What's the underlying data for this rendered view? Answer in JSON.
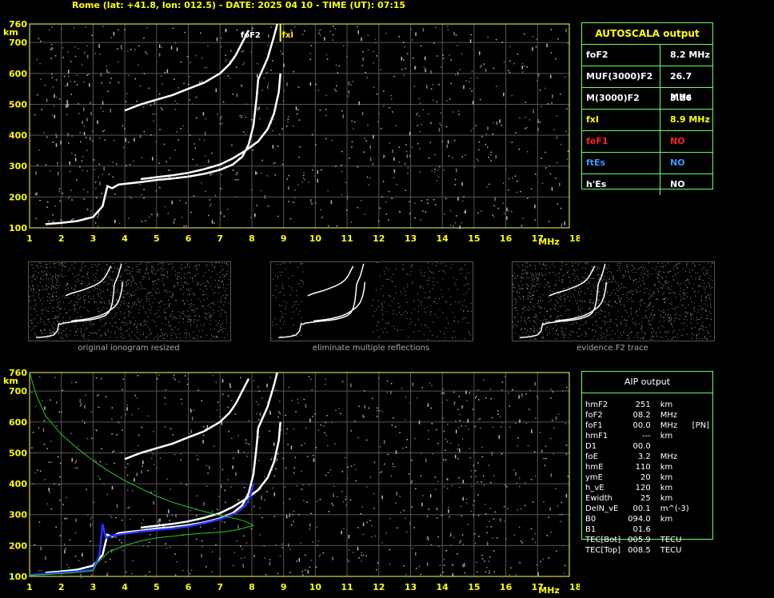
{
  "header": {
    "title": "Rome (lat: +41.8, lon: 012.5) - DATE: 2025 04 10 - TIME (UT): 07:15"
  },
  "chart_data": [
    {
      "type": "scatter",
      "title": "",
      "xlabel": "MHz",
      "ylabel": "km",
      "xlim": [
        1,
        18
      ],
      "ylim": [
        100,
        760
      ],
      "x_ticks": [
        1,
        2,
        3,
        4,
        5,
        6,
        7,
        8,
        9,
        10,
        11,
        12,
        13,
        14,
        15,
        16,
        17,
        18
      ],
      "y_ticks": [
        100,
        200,
        300,
        400,
        500,
        600,
        700,
        760
      ],
      "grid": true,
      "annotations": [
        {
          "text": "foF2",
          "x": 8.2,
          "color": "#ffffff"
        },
        {
          "text": "fxl",
          "x": 8.9,
          "color": "#ffff00"
        }
      ],
      "series": [
        {
          "color": "#ffffff",
          "points": [
            [
              1.5,
              112
            ],
            [
              2.0,
              116
            ],
            [
              2.5,
              122
            ],
            [
              3.0,
              135
            ],
            [
              3.3,
              170
            ],
            [
              3.45,
              235
            ],
            [
              3.6,
              228
            ],
            [
              3.8,
              240
            ],
            [
              4.5,
              248
            ],
            [
              5.0,
              255
            ],
            [
              5.5,
              260
            ],
            [
              6.0,
              266
            ],
            [
              6.5,
              275
            ],
            [
              7.0,
              288
            ],
            [
              7.4,
              305
            ],
            [
              7.7,
              330
            ],
            [
              7.9,
              370
            ],
            [
              8.05,
              430
            ],
            [
              8.15,
              520
            ],
            [
              8.2,
              580
            ],
            [
              8.5,
              650
            ],
            [
              8.7,
              720
            ],
            [
              8.8,
              760
            ]
          ]
        },
        {
          "color": "#ffffff",
          "points": [
            [
              4.5,
              258
            ],
            [
              5.0,
              264
            ],
            [
              5.5,
              270
            ],
            [
              6.0,
              278
            ],
            [
              6.5,
              290
            ],
            [
              7.0,
              305
            ],
            [
              7.4,
              325
            ],
            [
              7.8,
              350
            ],
            [
              8.2,
              380
            ],
            [
              8.5,
              420
            ],
            [
              8.7,
              470
            ],
            [
              8.85,
              540
            ],
            [
              8.9,
              600
            ]
          ]
        },
        {
          "color": "#ffffff",
          "points": [
            [
              4.0,
              480
            ],
            [
              4.5,
              500
            ],
            [
              5.0,
              515
            ],
            [
              5.5,
              530
            ],
            [
              6.0,
              550
            ],
            [
              6.5,
              570
            ],
            [
              7.0,
              600
            ],
            [
              7.3,
              630
            ],
            [
              7.5,
              660
            ],
            [
              7.7,
              700
            ],
            [
              7.9,
              740
            ]
          ]
        }
      ]
    },
    {
      "type": "scatter",
      "title": "",
      "xlabel": "MHz",
      "ylabel": "km",
      "xlim": [
        1,
        18
      ],
      "ylim": [
        100,
        760
      ],
      "x_ticks": [
        1,
        2,
        3,
        4,
        5,
        6,
        7,
        8,
        9,
        10,
        11,
        12,
        13,
        14,
        15,
        16,
        17,
        18
      ],
      "y_ticks": [
        100,
        200,
        300,
        400,
        500,
        600,
        700,
        760
      ],
      "grid": true,
      "series": [
        {
          "color": "#ffffff",
          "points": [
            [
              1.5,
              112
            ],
            [
              2.0,
              116
            ],
            [
              2.5,
              122
            ],
            [
              3.0,
              135
            ],
            [
              3.3,
              170
            ],
            [
              3.45,
              235
            ],
            [
              3.6,
              228
            ],
            [
              3.8,
              240
            ],
            [
              4.5,
              248
            ],
            [
              5.0,
              255
            ],
            [
              5.5,
              260
            ],
            [
              6.0,
              266
            ],
            [
              6.5,
              275
            ],
            [
              7.0,
              288
            ],
            [
              7.4,
              305
            ],
            [
              7.7,
              330
            ],
            [
              7.9,
              370
            ],
            [
              8.05,
              430
            ],
            [
              8.15,
              520
            ],
            [
              8.2,
              580
            ],
            [
              8.5,
              650
            ],
            [
              8.7,
              720
            ],
            [
              8.8,
              760
            ]
          ]
        },
        {
          "color": "#ffffff",
          "points": [
            [
              4.5,
              258
            ],
            [
              5.0,
              264
            ],
            [
              5.5,
              270
            ],
            [
              6.0,
              278
            ],
            [
              6.5,
              290
            ],
            [
              7.0,
              305
            ],
            [
              7.4,
              325
            ],
            [
              7.8,
              350
            ],
            [
              8.2,
              380
            ],
            [
              8.5,
              420
            ],
            [
              8.7,
              470
            ],
            [
              8.85,
              540
            ],
            [
              8.9,
              600
            ]
          ]
        },
        {
          "color": "#ffffff",
          "points": [
            [
              4.0,
              480
            ],
            [
              4.5,
              500
            ],
            [
              5.0,
              515
            ],
            [
              5.5,
              530
            ],
            [
              6.0,
              550
            ],
            [
              6.5,
              570
            ],
            [
              7.0,
              600
            ],
            [
              7.3,
              630
            ],
            [
              7.5,
              660
            ],
            [
              7.7,
              700
            ],
            [
              7.9,
              740
            ]
          ]
        },
        {
          "color": "#2233ff",
          "points": [
            [
              1.0,
              105
            ],
            [
              1.5,
              108
            ],
            [
              2.0,
              112
            ],
            [
              2.5,
              116
            ],
            [
              3.0,
              122
            ],
            [
              3.2,
              170
            ],
            [
              3.3,
              270
            ],
            [
              3.4,
              225
            ],
            [
              3.6,
              232
            ],
            [
              4.0,
              238
            ],
            [
              4.5,
              245
            ],
            [
              5.0,
              250
            ],
            [
              5.5,
              255
            ],
            [
              6.0,
              262
            ],
            [
              6.5,
              272
            ],
            [
              7.0,
              285
            ],
            [
              7.5,
              305
            ],
            [
              7.8,
              330
            ],
            [
              7.95,
              360
            ],
            [
              8.05,
              400
            ]
          ]
        },
        {
          "color": "#22cc22",
          "points": [
            [
              1.0,
              760
            ],
            [
              1.2,
              690
            ],
            [
              1.5,
              620
            ],
            [
              2.0,
              560
            ],
            [
              2.5,
              515
            ],
            [
              3.0,
              475
            ],
            [
              3.5,
              440
            ],
            [
              4.0,
              410
            ],
            [
              4.5,
              385
            ],
            [
              5.0,
              360
            ],
            [
              5.5,
              340
            ],
            [
              6.0,
              325
            ],
            [
              6.5,
              310
            ],
            [
              7.0,
              298
            ],
            [
              7.5,
              287
            ],
            [
              7.8,
              278
            ],
            [
              8.05,
              265
            ],
            [
              7.8,
              258
            ],
            [
              7.5,
              250
            ],
            [
              7.0,
              243
            ],
            [
              6.5,
              240
            ],
            [
              6.0,
              236
            ],
            [
              5.5,
              230
            ],
            [
              5.0,
              225
            ],
            [
              4.5,
              215
            ],
            [
              4.0,
              200
            ],
            [
              3.5,
              180
            ],
            [
              3.1,
              140
            ],
            [
              3.0,
              118
            ],
            [
              2.5,
              113
            ],
            [
              2.0,
              109
            ],
            [
              1.5,
              106
            ],
            [
              1.0,
              104
            ]
          ]
        }
      ]
    }
  ],
  "autoscala": {
    "title": "AUTOSCALA output",
    "rows": [
      {
        "key": "foF2",
        "value": "8.2 MHz",
        "color": "#ffffff"
      },
      {
        "key": "MUF(3000)F2",
        "value": "26.7 MHz",
        "color": "#ffffff"
      },
      {
        "key": "M(3000)F2",
        "value": "3.26",
        "color": "#ffffff"
      },
      {
        "key": "fxI",
        "value": "8.9 MHz",
        "color": "#ffff00"
      },
      {
        "key": "foF1",
        "value": "NO",
        "color": "#ff2222"
      },
      {
        "key": "ftEs",
        "value": "NO",
        "color": "#3399ff"
      },
      {
        "key": "h'Es",
        "value": "NO",
        "color": "#ffffff"
      }
    ]
  },
  "aip": {
    "title": "AIP output",
    "rows": [
      [
        "hmF2",
        "251",
        "km",
        ""
      ],
      [
        "foF2",
        "08.2",
        "MHz",
        ""
      ],
      [
        "foF1",
        "00.0",
        "MHz",
        "[PN]"
      ],
      [
        "hmF1",
        "---",
        "km",
        ""
      ],
      [
        "D1",
        "00.0",
        "",
        ""
      ],
      [
        "foE",
        "3.2",
        "MHz",
        ""
      ],
      [
        "hmE",
        "110",
        "km",
        ""
      ],
      [
        "ymE",
        "20",
        "km",
        ""
      ],
      [
        "h_vE",
        "120",
        "km",
        ""
      ],
      [
        "Ewidth",
        "25",
        "km",
        ""
      ],
      [
        "DelN_vE",
        "00.1",
        "m^(-3)",
        ""
      ],
      [
        "B0",
        "094.0",
        "km",
        ""
      ],
      [
        "B1",
        "01.6",
        "",
        ""
      ],
      [
        "TEC[Bot]",
        "005.9",
        "TECU",
        ""
      ],
      [
        "TEC[Top]",
        "008.5",
        "TECU",
        ""
      ]
    ]
  },
  "thumbnails": [
    {
      "label": "original ionogram resized"
    },
    {
      "label": "eliminate multiple reflections"
    },
    {
      "label": "evidence F2 trace"
    }
  ]
}
